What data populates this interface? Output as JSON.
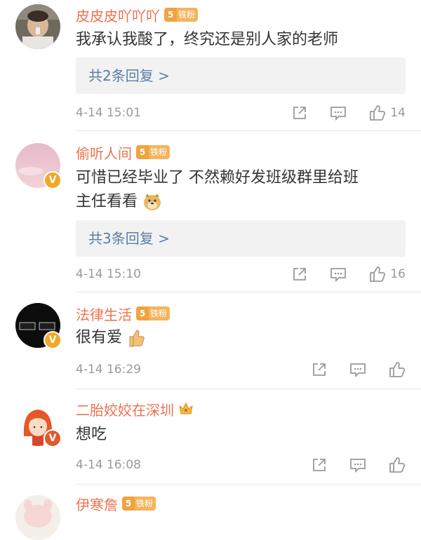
{
  "comments": [
    {
      "username": "皮皮皮吖吖吖",
      "fan_level": "5",
      "fan_label": "铁粉",
      "text": "我承认我酸了，终究还是别人家的老师",
      "reply_label": "共2条回复 >",
      "time": "4-14 15:01",
      "likes": "14"
    },
    {
      "username": "偷听人间",
      "fan_level": "5",
      "fan_label": "铁粉",
      "text_line1": "可惜已经毕业了 不然赖好发班级群里给班",
      "text_line2": "主任看看",
      "reply_label": "共3条回复 >",
      "time": "4-14 15:10",
      "likes": "16"
    },
    {
      "username": "法律生活",
      "fan_level": "5",
      "fan_label": "铁粉",
      "text": "很有爱",
      "time": "4-14 16:29",
      "likes": ""
    },
    {
      "username": "二胎姣姣在深圳",
      "text": "想吃",
      "time": "4-14 16:08",
      "likes": ""
    },
    {
      "username": "伊寒詹",
      "fan_level": "5",
      "fan_label": "铁粉"
    }
  ],
  "colors": {
    "username": "#eb7350",
    "link": "#5b7ea8",
    "meta": "#9a9a9a",
    "verified": "#f5a623"
  },
  "icons": [
    "share-icon",
    "comment-icon",
    "like-icon",
    "crown-icon",
    "verified-v-icon",
    "doge-emoji",
    "thumbs-up-emoji"
  ]
}
